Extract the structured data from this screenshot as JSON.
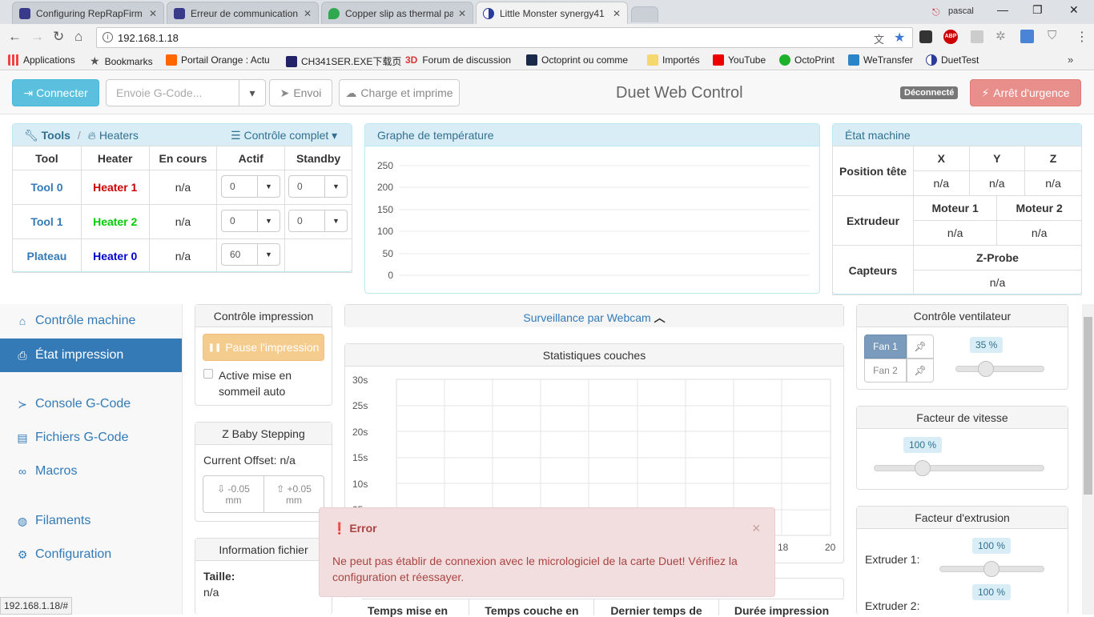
{
  "browser": {
    "tabs": [
      {
        "title": "Configuring RepRapFirm"
      },
      {
        "title": "Erreur de communication"
      },
      {
        "title": "Copper slip as thermal pa"
      },
      {
        "title": "Little Monster synergy41"
      }
    ],
    "profile": "pascal",
    "url": "192.168.1.18",
    "bookmarks": [
      "Applications",
      "Bookmarks",
      "Portail Orange : Actu",
      "CH341SER.EXE下载页",
      "Forum de discussion",
      "Octoprint ou comme",
      "Importés",
      "YouTube",
      "OctoPrint",
      "WeTransfer",
      "DuetTest"
    ],
    "status_url": "192.168.1.18/#"
  },
  "navbar": {
    "connect": "Connecter",
    "gcode_placeholder": "Envoie G-Code...",
    "send": "Envoi",
    "upload": "Charge et imprime",
    "brand": "Duet Web Control",
    "status": "Déconnecté",
    "estop": "Arrêt d'urgence"
  },
  "tools": {
    "crumb_tools": "Tools",
    "crumb_sep": "/",
    "crumb_heaters": "Heaters",
    "control": "Contrôle complet",
    "headers": [
      "Tool",
      "Heater",
      "En cours",
      "Actif",
      "Standby"
    ],
    "rows": [
      {
        "tool": "Tool 0",
        "heater": "Heater 1",
        "heater_color": "#cc0000",
        "current": "n/a",
        "active": "0",
        "standby": "0"
      },
      {
        "tool": "Tool 1",
        "heater": "Heater 2",
        "heater_color": "#00cc00",
        "current": "n/a",
        "active": "0",
        "standby": "0"
      },
      {
        "tool": "Plateau",
        "heater": "Heater 0",
        "heater_color": "#0000cc",
        "current": "n/a",
        "active": "60",
        "standby": ""
      }
    ]
  },
  "temp_graph": {
    "title": "Graphe de température",
    "ticks": [
      "250",
      "200",
      "150",
      "100",
      "50",
      "0"
    ]
  },
  "machine": {
    "title": "État machine",
    "pos_label": "Position tête",
    "axes": [
      "X",
      "Y",
      "Z"
    ],
    "pos_values": [
      "n/a",
      "n/a",
      "n/a"
    ],
    "extruder_label": "Extrudeur",
    "motors": [
      "Moteur 1",
      "Moteur 2"
    ],
    "motor_values": [
      "n/a",
      "n/a"
    ],
    "sensors_label": "Capteurs",
    "probe": "Z-Probe",
    "probe_value": "n/a"
  },
  "sidebar": {
    "items": [
      {
        "label": "Contrôle machine",
        "icon": "home-icon"
      },
      {
        "label": "État impression",
        "icon": "print-icon"
      },
      {
        "label": "Console G-Code",
        "icon": "terminal-icon"
      },
      {
        "label": "Fichiers G-Code",
        "icon": "drive-icon"
      },
      {
        "label": "Macros",
        "icon": "link-icon"
      },
      {
        "label": "Filaments",
        "icon": "globe-icon"
      },
      {
        "label": "Configuration",
        "icon": "gear-icon"
      }
    ]
  },
  "print_control": {
    "title": "Contrôle impression",
    "pause": "Pause l'impression",
    "sleep_line1": "Active mise en",
    "sleep_line2": "sommeil auto"
  },
  "babystep": {
    "title": "Z Baby Stepping",
    "offset": "Current Offset: n/a",
    "minus": "-0.05",
    "plus": "+0.05",
    "unit": "mm"
  },
  "file_info": {
    "title": "Information fichier",
    "size_label": "Taille:",
    "size_value": "n/a"
  },
  "webcam": {
    "title": "Surveillance par Webcam"
  },
  "layer_stats": {
    "title": "Statistiques couches",
    "yticks": [
      "30s",
      "25s",
      "20s",
      "15s",
      "10s",
      "05"
    ],
    "xticks": [
      "18",
      "20"
    ]
  },
  "times_table": {
    "headers": [
      "Temps mise en",
      "Temps couche en",
      "Dernier temps de",
      "Durée impression"
    ]
  },
  "fan": {
    "title": "Contrôle ventilateur",
    "fan1": "Fan 1",
    "fan2": "Fan 2",
    "value": "35 %",
    "level": 35
  },
  "speed": {
    "title": "Facteur de vitesse",
    "value": "100 %"
  },
  "extrusion": {
    "title": "Facteur d'extrusion",
    "e1": "Extruder 1:",
    "e1_value": "100 %",
    "e2": "Extruder 2:",
    "e2_value": "100 %"
  },
  "error": {
    "title": "Error",
    "close": "×",
    "message_line1": "Ne peut pas établir de connexion avec le micrologiciel de la carte Duet! Vérifiez la",
    "message_line2": "configuration et réessayer."
  }
}
